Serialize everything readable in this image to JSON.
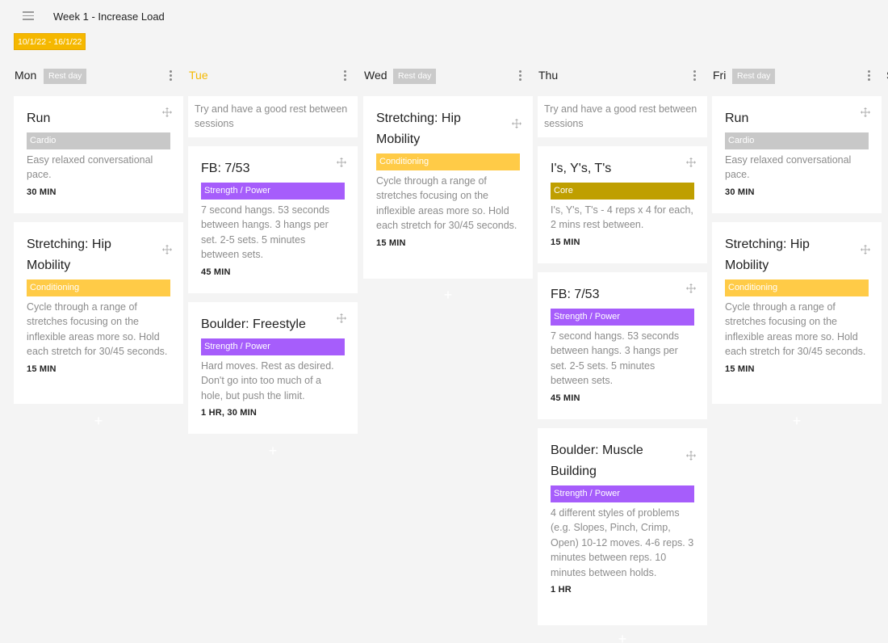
{
  "header": {
    "title": "Week 1 - Increase Load",
    "date_range": "10/1/22 - 16/1/22",
    "menu_icon": "hamburger-menu-icon"
  },
  "colors": {
    "accent": "#f5b800",
    "cardio": "#c8c8c8",
    "conditioning": "#ffcb47",
    "strength": "#a65dfb",
    "core": "#bf9f00"
  },
  "days": {
    "mon": {
      "name": "Mon",
      "rest_label": "Rest day",
      "cards": [
        {
          "title": "Run",
          "tag": "Cardio",
          "desc": "Easy relaxed conversational pace.",
          "duration": "30 MIN"
        },
        {
          "title": "Stretching: Hip Mobility",
          "tag": "Conditioning",
          "desc": "Cycle through a range of stretches focusing on the inflexible areas more so. Hold each stretch for 30/45 seconds.",
          "duration": "15 MIN"
        }
      ]
    },
    "tue": {
      "name": "Tue",
      "note": "Try and have a good rest between sessions",
      "cards": [
        {
          "title": "FB: 7/53",
          "tag": "Strength / Power",
          "desc": "7 second hangs. 53 seconds between hangs. 3 hangs per set. 2-5 sets. 5 minutes between sets.",
          "duration": "45 MIN"
        },
        {
          "title": "Boulder: Freestyle",
          "tag": "Strength / Power",
          "desc": "Hard moves. Rest as desired. Don't go into too much of a hole, but push the limit.",
          "duration": "1 HR, 30 MIN"
        }
      ]
    },
    "wed": {
      "name": "Wed",
      "rest_label": "Rest day",
      "cards": [
        {
          "title": "Stretching: Hip Mobility",
          "tag": "Conditioning",
          "desc": "Cycle through a range of stretches focusing on the inflexible areas more so. Hold each stretch for 30/45 seconds.",
          "duration": "15 MIN"
        }
      ]
    },
    "thu": {
      "name": "Thu",
      "note": "Try and have a good rest between sessions",
      "cards": [
        {
          "title": "I's, Y's, T's",
          "tag": "Core",
          "desc": "I's, Y's, T's - 4 reps x 4 for each, 2 mins rest between.",
          "duration": "15 MIN"
        },
        {
          "title": "FB: 7/53",
          "tag": "Strength / Power",
          "desc": "7 second hangs. 53 seconds between hangs. 3 hangs per set. 2-5 sets. 5 minutes between sets.",
          "duration": "45 MIN"
        },
        {
          "title": "Boulder: Muscle Building",
          "tag": "Strength / Power",
          "desc": "4 different styles of problems (e.g. Slopes, Pinch, Crimp, Open) 10-12 moves. 4-6 reps. 3 minutes between reps. 10 minutes between holds.",
          "duration": "1 HR"
        }
      ]
    },
    "fri": {
      "name": "Fri",
      "rest_label": "Rest day",
      "cards": [
        {
          "title": "Run",
          "tag": "Cardio",
          "desc": "Easy relaxed conversational pace.",
          "duration": "30 MIN"
        },
        {
          "title": "Stretching: Hip Mobility",
          "tag": "Conditioning",
          "desc": "Cycle through a range of stretches focusing on the inflexible areas more so. Hold each stretch for 30/45 seconds.",
          "duration": "15 MIN"
        }
      ]
    },
    "sat": {
      "name": "S"
    }
  }
}
